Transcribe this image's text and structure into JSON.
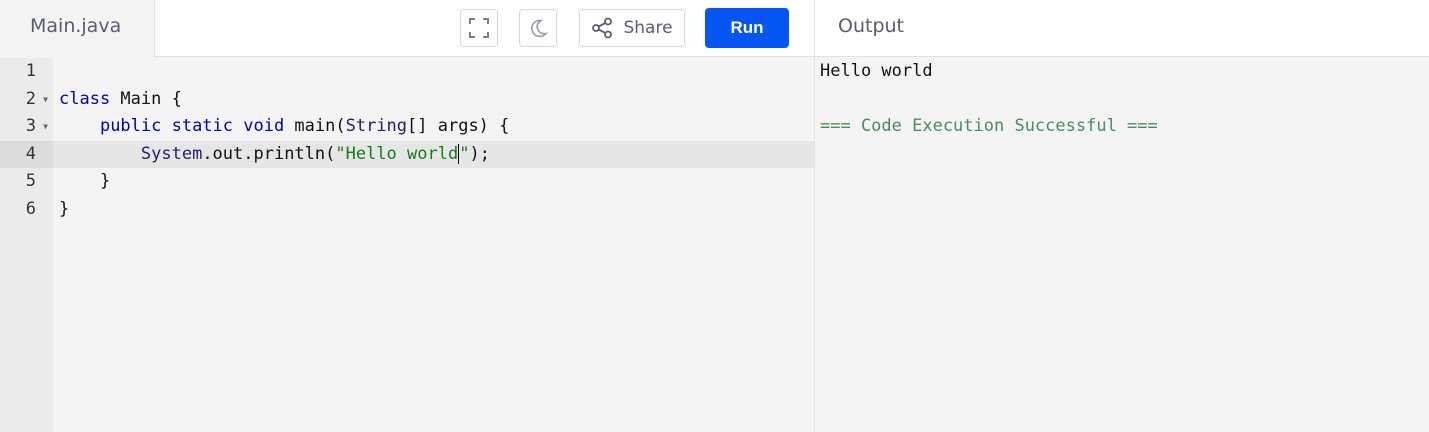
{
  "header": {
    "file_tab": "Main.java",
    "share_label": "Share",
    "run_label": "Run",
    "output_title": "Output"
  },
  "editor": {
    "line_numbers": [
      "1",
      "2",
      "3",
      "4",
      "5",
      "6"
    ],
    "active_line": 4,
    "folding_lines": [
      2,
      3
    ],
    "code": {
      "line2": {
        "kw": "class",
        "rest": " Main {"
      },
      "line3": {
        "indent": "    ",
        "kw": "public static void",
        "rest": " main(",
        "type": "String",
        "rest2": "[] args) {"
      },
      "line4": {
        "indent": "        ",
        "obj": "System",
        "mid": ".out.println(",
        "str_before": "\"Hello world",
        "str_after": "\"",
        "end": ");"
      },
      "line5": "    }",
      "line6": "}"
    }
  },
  "output": {
    "lines": [
      "Hello world",
      "",
      "=== Code Execution Successful ==="
    ]
  },
  "colors": {
    "run_button": "#0556f3",
    "success_text": "#4d8a62",
    "keyword": "#0000bb",
    "string": "#1a7a1a"
  },
  "icons": [
    "fullscreen-icon",
    "moon-icon",
    "share-icon"
  ]
}
